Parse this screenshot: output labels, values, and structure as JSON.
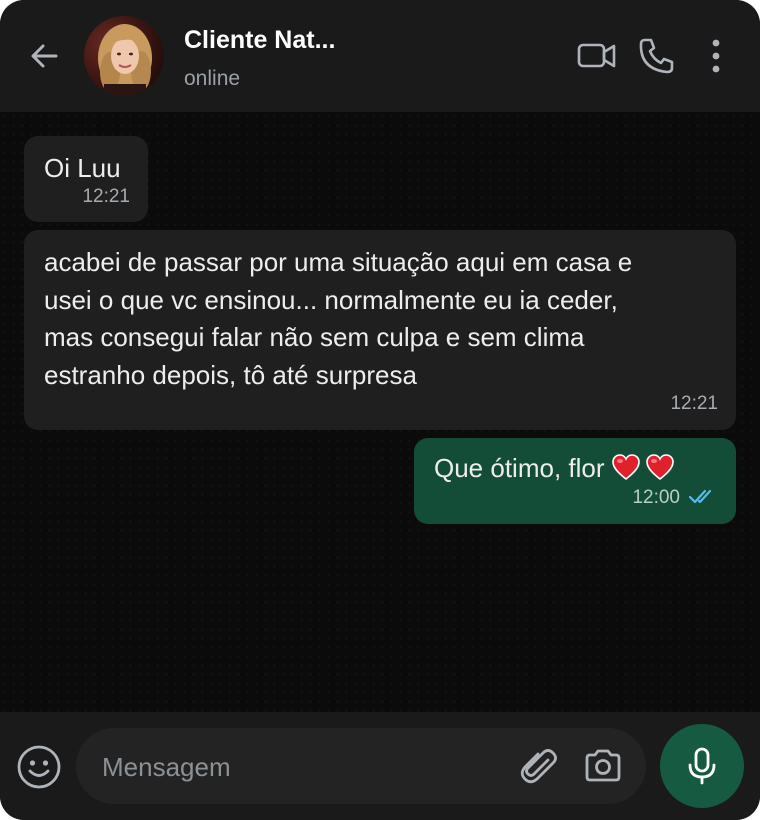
{
  "header": {
    "title": "Cliente Nat...",
    "status": "online"
  },
  "messages": [
    {
      "direction": "incoming",
      "lines": [
        "Oi Luu"
      ],
      "time": "12:21"
    },
    {
      "direction": "incoming",
      "lines": [
        "acabei de passar por uma situação aqui em casa e",
        "usei o que vc ensinou... normalmente eu ia ceder,",
        "mas consegui falar não sem culpa e sem clima",
        "estranho depois, tô até surpresa"
      ],
      "time": "12:21"
    },
    {
      "direction": "outgoing",
      "text": "Que ótimo, flor",
      "emojis": [
        "red-heart-emoji",
        "red-heart-emoji"
      ],
      "time": "12:00",
      "receipt": "read"
    }
  ],
  "composer": {
    "placeholder": "Mensagem"
  },
  "colors": {
    "header_bg": "#1a1a1a",
    "chat_bg": "#0b0b0b",
    "incoming_bubble": "#1f1f1f",
    "outgoing_bubble": "#144d37",
    "mic_button": "#155a41",
    "read_receipt": "#53bdeb"
  },
  "icons": {
    "back": "arrow-left-icon",
    "video": "video-camera-icon",
    "call": "phone-icon",
    "menu": "more-vertical-icon",
    "emoji": "emoji-smile-icon",
    "attach": "paperclip-icon",
    "camera": "camera-icon",
    "mic": "microphone-icon"
  }
}
